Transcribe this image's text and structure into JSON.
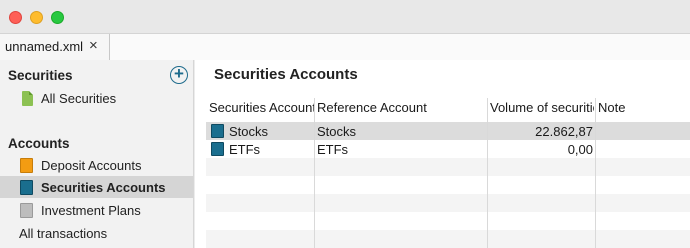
{
  "window": {
    "tab_label": "unnamed.xml",
    "tab_close_icon": "×"
  },
  "sidebar": {
    "securities_heading": "Securities",
    "add_icon": "+",
    "securities_items": [
      {
        "label": "All Securities",
        "icon": "document-icon"
      }
    ],
    "accounts_heading": "Accounts",
    "accounts_items": [
      {
        "label": "Deposit Accounts",
        "icon": "deposit-account-icon"
      },
      {
        "label": "Securities Accounts",
        "icon": "securities-account-icon",
        "selected": true
      },
      {
        "label": "Investment Plans",
        "icon": "investment-plan-icon"
      }
    ],
    "all_transactions": "All transactions"
  },
  "main": {
    "title": "Securities Accounts",
    "columns": [
      "Securities Account",
      "Reference Account",
      "Volume of securities",
      "Note"
    ],
    "rows": [
      {
        "name": "Stocks",
        "reference": "Stocks",
        "volume": "22.862,87",
        "note": ""
      },
      {
        "name": "ETFs",
        "reference": "ETFs",
        "volume": "0,00",
        "note": ""
      }
    ]
  },
  "colors": {
    "accent": "#1a6e8e",
    "selection": "#dcdcdc"
  }
}
